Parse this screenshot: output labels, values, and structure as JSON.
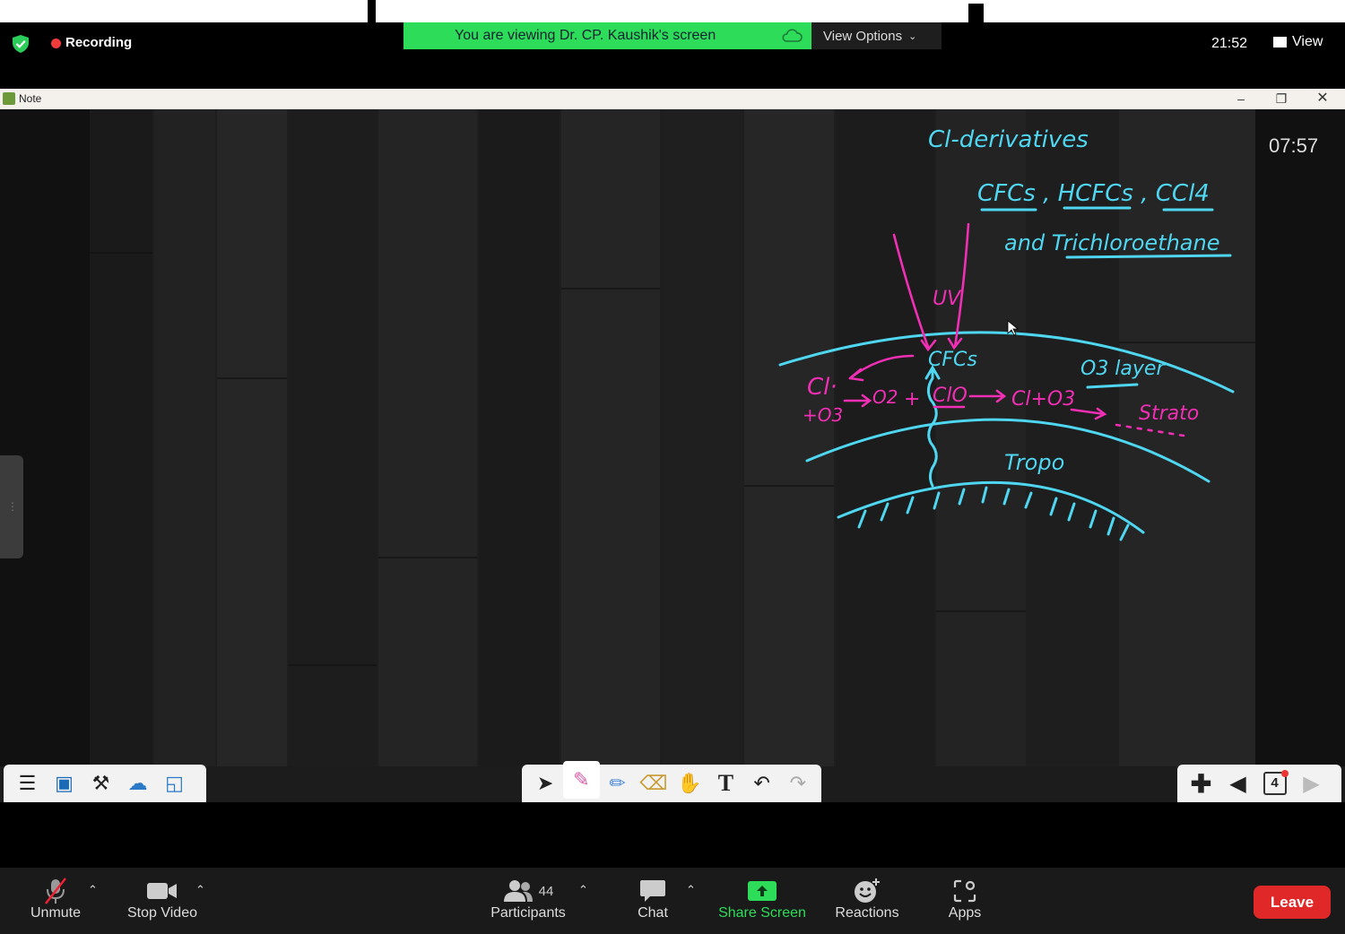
{
  "meeting": {
    "recording_label": "Recording",
    "banner_text": "You are viewing Dr. CP. Kaushik's screen",
    "view_options_label": "View Options",
    "clock": "21:52",
    "view_label": "View"
  },
  "note_window": {
    "title": "Note",
    "timer": "07:57",
    "page_number": "4"
  },
  "whiteboard": {
    "heading": "Cl-derivatives",
    "compounds": "CFCs , HCFCs , CCl4",
    "compounds_2": "and Trichloroethane",
    "uv": "UV",
    "cfcs": "CFCs",
    "cl_radical": "Cl·",
    "o3_plus": "+O3",
    "o2": "O2",
    "plus": "+",
    "clo": "ClO",
    "cl_o3": "Cl+O3",
    "ozone_layer": "O3 layer",
    "strato": "Strato",
    "tropo": "Tropo",
    "colors": {
      "cyan": "#4fd6f0",
      "magenta": "#f02fb4"
    }
  },
  "bottom_bar": {
    "unmute": "Unmute",
    "stop_video": "Stop Video",
    "participants_count": "44",
    "participants": "Participants",
    "chat": "Chat",
    "share_screen": "Share Screen",
    "reactions": "Reactions",
    "apps": "Apps",
    "leave": "Leave"
  },
  "colors": {
    "share_green": "#2ddd59",
    "leave_red": "#e02828"
  }
}
